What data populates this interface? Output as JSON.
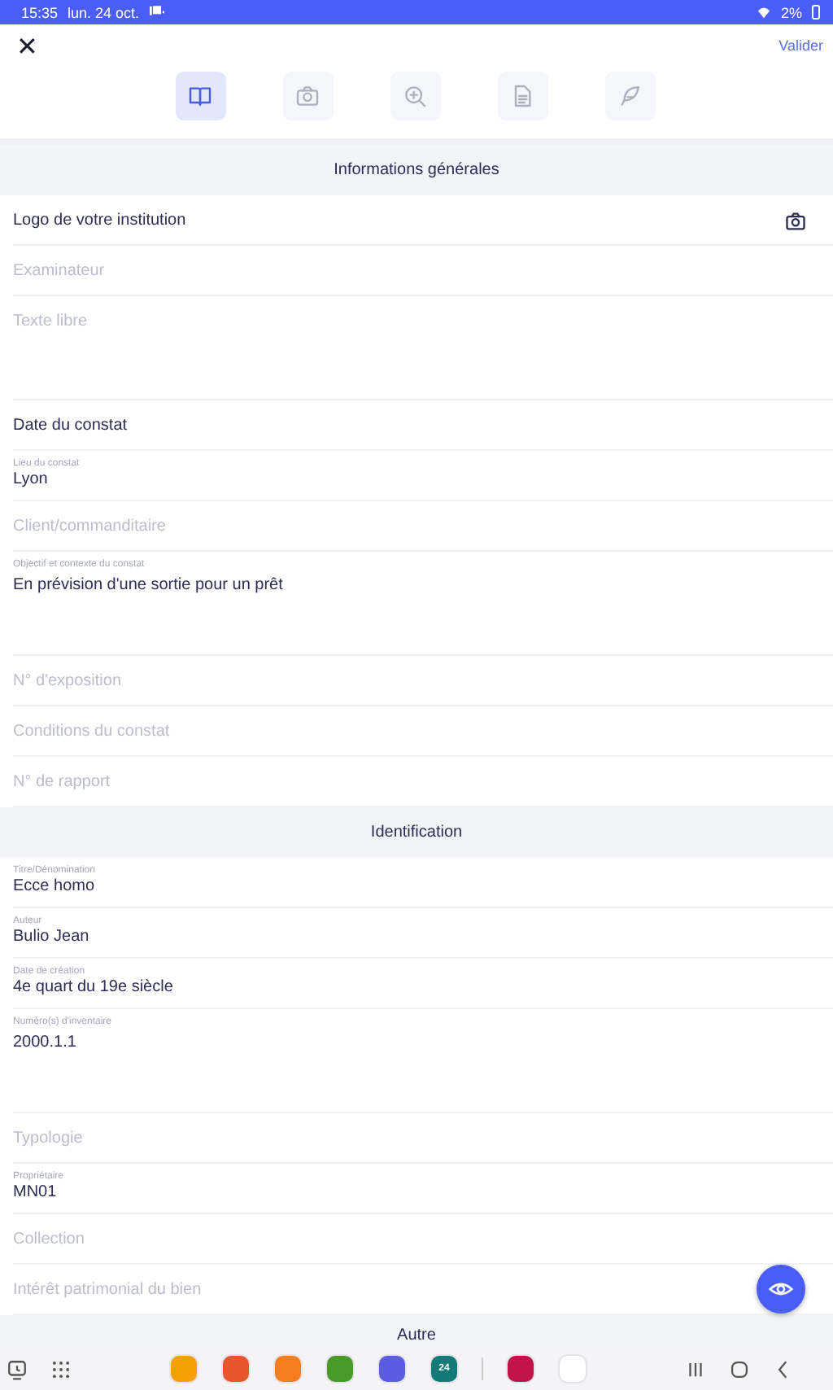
{
  "status_bar": {
    "time": "15:35",
    "date": "lun. 24 oct.",
    "battery": "2%"
  },
  "header": {
    "close": "✕",
    "action": "Valider"
  },
  "tabs": [
    {
      "selected": true
    },
    {
      "selected": false
    },
    {
      "selected": false
    },
    {
      "selected": false
    },
    {
      "selected": false
    }
  ],
  "sections": [
    {
      "title": "Informations générales",
      "fields": [
        {
          "kind": "image",
          "text": "Logo de votre institution"
        },
        {
          "kind": "placeholder",
          "placeholder": "Examinateur"
        },
        {
          "kind": "placeholder",
          "placeholder": "Texte libre",
          "multiline": true
        },
        {
          "kind": "action",
          "text": "Date du constat"
        },
        {
          "kind": "value",
          "label": "Lieu du constat",
          "value": "Lyon"
        },
        {
          "kind": "placeholder",
          "placeholder": "Client/commanditaire"
        },
        {
          "kind": "value",
          "label": "Objectif et contexte du constat",
          "value": "En prévision d'une sortie pour un prêt",
          "multiline": true
        },
        {
          "kind": "placeholder",
          "placeholder": "N° d'exposition"
        },
        {
          "kind": "placeholder",
          "placeholder": "Conditions du constat"
        },
        {
          "kind": "placeholder",
          "placeholder": "N° de rapport"
        }
      ]
    },
    {
      "title": "Identification",
      "fields": [
        {
          "kind": "value",
          "label": "Titre/Dénomination",
          "value": "Ecce homo"
        },
        {
          "kind": "value",
          "label": "Auteur",
          "value": "Bulio Jean"
        },
        {
          "kind": "value",
          "label": "Date de création",
          "value": "4e quart du 19e siècle"
        },
        {
          "kind": "value",
          "label": "Numéro(s) d'inventaire",
          "value": "2000.1.1",
          "multiline": true
        },
        {
          "kind": "placeholder",
          "placeholder": "Typologie"
        },
        {
          "kind": "value",
          "label": "Propriétaire",
          "value": "MN01"
        },
        {
          "kind": "placeholder",
          "placeholder": "Collection"
        },
        {
          "kind": "placeholder",
          "placeholder": "Intérêt patrimonial du bien"
        }
      ]
    },
    {
      "title": "Autre"
    }
  ],
  "dock": [
    {
      "color": "#f5a000"
    },
    {
      "color": "#e8562f"
    },
    {
      "color": "#f57c1f"
    },
    {
      "color": "#4a9a2a"
    },
    {
      "color": "#5b5ce0"
    },
    {
      "color": "#127b78",
      "text": "24"
    },
    {
      "color": "#c2134d"
    },
    {
      "color": "#ffffff"
    }
  ]
}
